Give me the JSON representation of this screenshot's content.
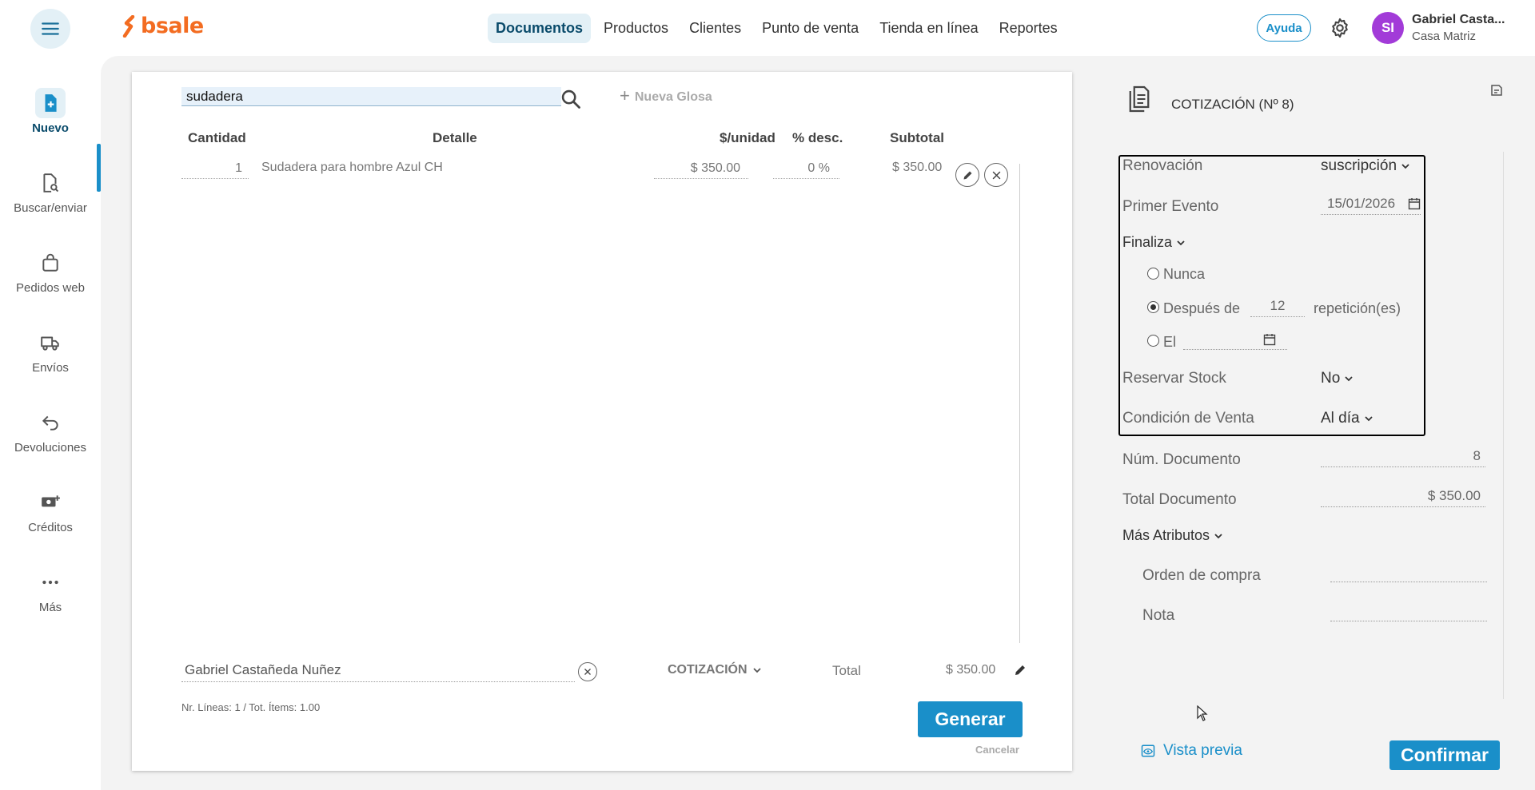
{
  "brand": {
    "name": "bsale",
    "color": "#f36c21"
  },
  "colors": {
    "accent": "#1a8fc9",
    "active_bg": "#e3f0f6",
    "avatar": "#a23bd8"
  },
  "nav": [
    {
      "label": "Documentos",
      "active": true
    },
    {
      "label": "Productos"
    },
    {
      "label": "Clientes"
    },
    {
      "label": "Punto de venta"
    },
    {
      "label": "Tienda en línea"
    },
    {
      "label": "Reportes"
    }
  ],
  "header": {
    "help_label": "Ayuda",
    "user_initials": "SI",
    "user_name": "Gabriel Casta...",
    "user_branch": "Casa Matriz"
  },
  "sidebar": {
    "items": [
      {
        "label": "Nuevo",
        "icon": "new-document-icon",
        "active": true
      },
      {
        "label": "Buscar/enviar",
        "icon": "document-search-icon"
      },
      {
        "label": "Pedidos web",
        "icon": "shopping-bag-icon"
      },
      {
        "label": "Envíos",
        "icon": "truck-icon"
      },
      {
        "label": "Devoluciones",
        "icon": "return-arrow-icon"
      },
      {
        "label": "Créditos",
        "icon": "cash-plus-icon"
      },
      {
        "label": "Más",
        "icon": "more-dots-icon"
      }
    ]
  },
  "document": {
    "search_value": "sudadera",
    "new_gloss_label": "Nueva Glosa",
    "columns": {
      "quantity": "Cantidad",
      "detail": "Detalle",
      "unit_price": "$/unidad",
      "discount": "% desc.",
      "subtotal": "Subtotal"
    },
    "lines": [
      {
        "quantity": "1",
        "detail": "Sudadera para hombre Azul CH",
        "unit_price": "$ 350.00",
        "discount": "0 %",
        "subtotal": "$ 350.00"
      }
    ],
    "client": "Gabriel Castañeda Nuñez",
    "doc_type": "COTIZACIÓN",
    "total_label": "Total",
    "total_value": "$ 350.00",
    "lines_info": "Nr. Líneas: 1 / Tot. Ítems: 1.00",
    "generate_label": "Generar",
    "cancel_label": "Cancelar"
  },
  "panel": {
    "title": "COTIZACIÓN (Nº 8)",
    "renewal_label": "Renovación",
    "renewal_value": "suscripción",
    "first_event_label": "Primer Evento",
    "first_event_value": "15/01/2026",
    "ends_label": "Finaliza",
    "ends_options": {
      "never": "Nunca",
      "after": "Después de",
      "after_count": "12",
      "after_suffix": "repetición(es)",
      "on": "El",
      "selected": "after"
    },
    "reserve_stock_label": "Reservar Stock",
    "reserve_stock_value": "No",
    "sale_condition_label": "Condición de Venta",
    "sale_condition_value": "Al día",
    "doc_number_label": "Núm. Documento",
    "doc_number_value": "8",
    "doc_total_label": "Total Documento",
    "doc_total_value": "$ 350.00",
    "more_attrs_label": "Más Atributos",
    "purchase_order_label": "Orden de compra",
    "purchase_order_value": "",
    "note_label": "Nota",
    "note_value": "",
    "preview_label": "Vista previa",
    "confirm_label": "Confirmar"
  }
}
